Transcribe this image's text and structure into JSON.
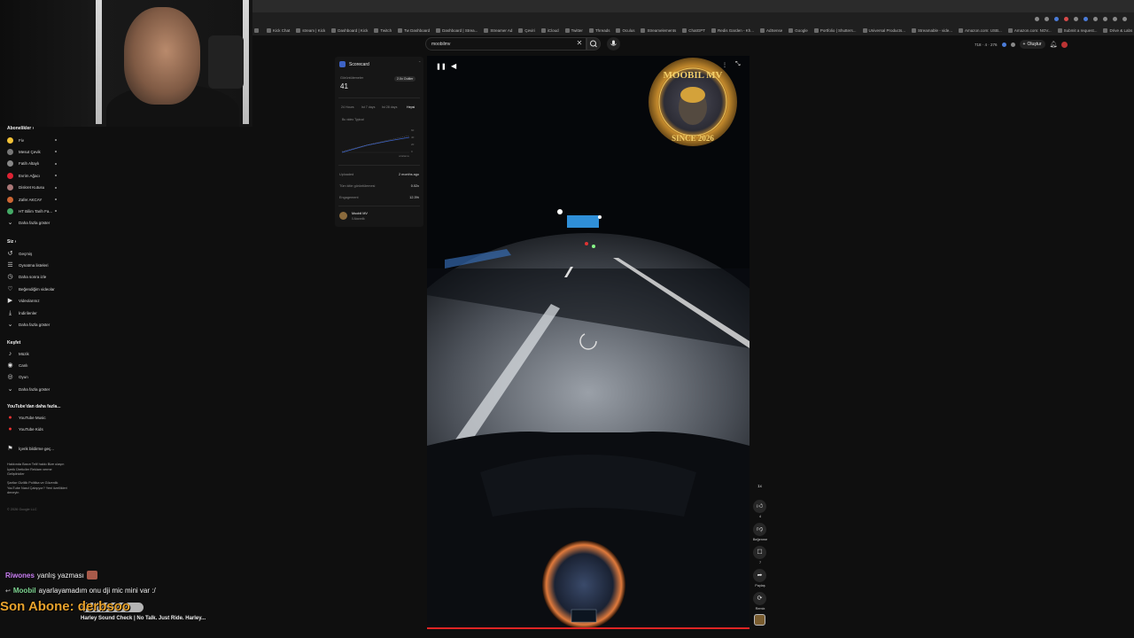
{
  "bookmarks": [
    "",
    "Kick Chat",
    "stream | Kick",
    "Dashboard | Kick",
    "Twitch",
    "Tw Dashboard",
    "Dashboard | Strea...",
    "Streamer Ad",
    "Çeviri",
    "iCloud",
    "Twitter",
    "Threads",
    "Oculus",
    "Streamelements",
    "ChatGPT",
    "Redis Garden - Kh...",
    "AdSense",
    "Google",
    "Portfolio | Shutters...",
    "Universal Products...",
    "Streamable - vide...",
    "Amazon.com: USB...",
    "Amazon.com: NOV...",
    "Submit a request...",
    "Drive & Labs",
    "Tüm Yer İşaretleri"
  ],
  "header": {
    "search_value": "moobilmv",
    "clear_icon": "close-icon",
    "create_label": "Oluştur",
    "stats": "718  ·  4  ·  276"
  },
  "sidebar": {
    "subs_title": "Abonelikler",
    "subscriptions": [
      "Fiv",
      "Mesut Çevik",
      "Fatih Altaylı",
      "Evrim Ağacı",
      "Diskret Kutusu",
      "Zafer AKCAY",
      "HT Bilim Tarih Fa..."
    ],
    "show_more": "Daha fazla göster",
    "you_title": "Siz",
    "you_items": [
      "Geçmiş",
      "Oynatma listeleri",
      "Daha sonra izle",
      "Beğendiğim videolar",
      "Videolarınız",
      "İndirilenler",
      "Daha fazla göster"
    ],
    "explore_title": "Keşfet",
    "explore_items": [
      "Müzik",
      "Canlı",
      "Oyun",
      "Daha fazla göster"
    ],
    "more_title": "YouTube'dan daha fazla...",
    "more_items": [
      "YouTube Music",
      "YouTube Kids"
    ],
    "report_item": "İçerik bildirme geç...",
    "footer1": "Hakkında  Basın  Telif hakkı  Bize ulaşın  İçerik Üreticiler  Reklam verme  Geliştiriciler",
    "footer2": "Şartlar  Gizlilik  Politika ve Güvenlik  YouTube Nasıl Çalışıyor?  Yeni özellikleri deneyin",
    "copyright": "© 2026 Google LLC"
  },
  "scorecard": {
    "title": "Scorecard",
    "views_label": "Görüntülemeler",
    "views_value": "41",
    "outlier_pill": "2.0x Outlier",
    "tabs": [
      "24 Hours",
      "Ist 7 days",
      "Ist 28 days",
      "Hepsi"
    ],
    "legend": "Bu video  Typical",
    "uploaded_label": "Uploaded",
    "uploaded_value": "2 months ago",
    "views_ratio_label": "Tüm kitle görüntülemesi",
    "views_ratio_value": "0.02x",
    "engagement_label": "Engagement",
    "engagement_value": "12.3%",
    "channel_name": "Moobil MV",
    "channel_subs": "0 Abonelik",
    "chart_ticks": [
      "60",
      "40",
      "20",
      "0"
    ],
    "chart_x_label": "ortalama"
  },
  "video": {
    "badge_line1": "MOOBIL MV",
    "badge_line2": "SINCE 2026",
    "speed": "1x"
  },
  "rail": {
    "like_count": "4",
    "dislike_label": "Beğenme",
    "comment_count": "7",
    "share_label": "Paylaş",
    "remix_label": "Remix"
  },
  "chat": [
    {
      "user": "Riwones",
      "user_color": "#c87cf2",
      "text": "yanlış yazması"
    },
    {
      "user": "Moobil",
      "user_color": "#7ad18e",
      "text": "ayarlayamadım onu dji mic mini var :/"
    }
  ],
  "last_sub": "Son Abone: derbsoo",
  "now_playing": "Harley Sound Check | No Talk. Just Ride. Harley..."
}
